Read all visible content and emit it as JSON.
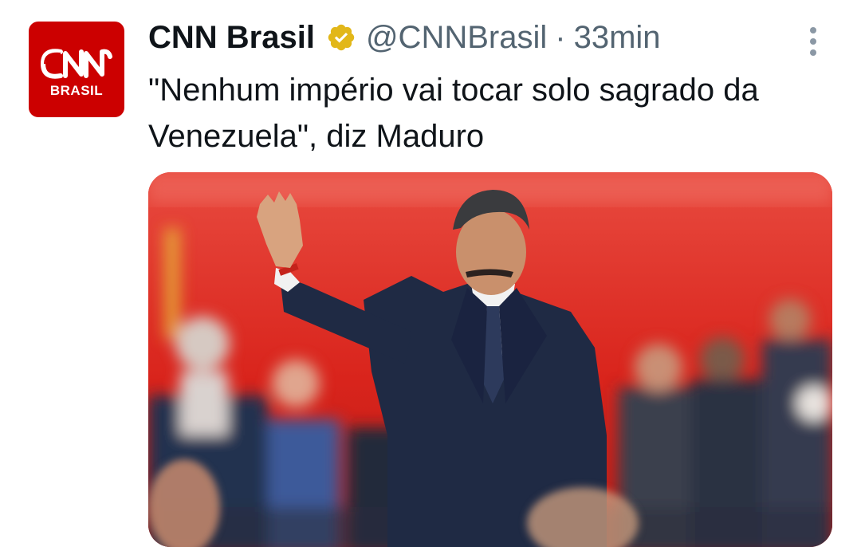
{
  "tweet": {
    "author": {
      "name": "CNN Brasil",
      "handle": "@CNNBrasil",
      "verified_badge": "gold-verified-badge-icon",
      "avatar": {
        "logo_text": "CNN",
        "subtitle": "BRASIL",
        "background": "#cc0000"
      }
    },
    "separator": "·",
    "timestamp": "33min",
    "text": "\"Nenhum império vai tocar solo sagrado da Venezuela\", diz Maduro",
    "more_icon": "more-vertical-icon",
    "media": {
      "background": "#e02a22"
    }
  }
}
